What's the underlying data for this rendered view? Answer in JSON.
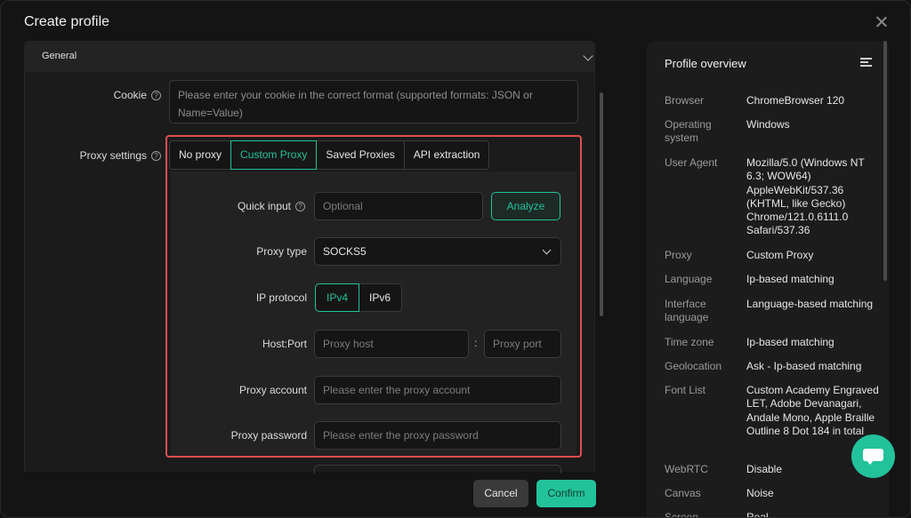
{
  "modal": {
    "title": "Create profile"
  },
  "general": {
    "label": "General"
  },
  "cookie": {
    "label": "Cookie",
    "placeholder": "Please enter your cookie in the correct format (supported formats: JSON or Name=Value)"
  },
  "proxy": {
    "label": "Proxy settings",
    "tabs": [
      "No proxy",
      "Custom Proxy",
      "Saved Proxies",
      "API extraction"
    ],
    "active_tab": "Custom Proxy",
    "quick_input": {
      "label": "Quick input",
      "placeholder": "Optional",
      "button": "Analyze"
    },
    "proxy_type": {
      "label": "Proxy type",
      "value": "SOCKS5"
    },
    "ip_protocol": {
      "label": "IP protocol",
      "options": [
        "IPv4",
        "IPv6"
      ],
      "selected": "IPv4"
    },
    "host_port": {
      "label": "Host:Port",
      "host_placeholder": "Proxy host",
      "separator": ":",
      "port_placeholder": "Proxy port"
    },
    "account": {
      "label": "Proxy account",
      "placeholder": "Please enter the proxy account"
    },
    "password": {
      "label": "Proxy password",
      "placeholder": "Please enter the proxy password"
    }
  },
  "footer": {
    "cancel": "Cancel",
    "confirm": "Confirm"
  },
  "overview": {
    "title": "Profile overview",
    "rows": [
      {
        "key": "Browser",
        "value": "ChromeBrowser 120"
      },
      {
        "key": "Operating system",
        "value": "Windows"
      },
      {
        "key": "User Agent",
        "value": "Mozilla/5.0 (Windows NT 6.3; WOW64) AppleWebKit/537.36 (KHTML, like Gecko) Chrome/121.0.6111.0 Safari/537.36"
      },
      {
        "key": "Proxy",
        "value": "Custom Proxy"
      },
      {
        "key": "Language",
        "value": "Ip-based matching"
      },
      {
        "key": "Interface language",
        "value": "Language-based matching"
      },
      {
        "key": "Time zone",
        "value": "Ip-based matching"
      },
      {
        "key": "Geolocation",
        "value": "Ask - Ip-based matching"
      },
      {
        "key": "Font List",
        "value": "Custom Academy Engraved LET, Adobe Devanagari, Andale Mono, Apple Braille Outline 8 Dot 184 in total"
      },
      {
        "key": "WebRTC",
        "value": "Disable"
      },
      {
        "key": "Canvas",
        "value": "Noise"
      },
      {
        "key": "Screen",
        "value": "Real"
      }
    ]
  },
  "colors": {
    "accent": "#22c29a",
    "highlight": "#e04e4e",
    "background": "#141414"
  }
}
